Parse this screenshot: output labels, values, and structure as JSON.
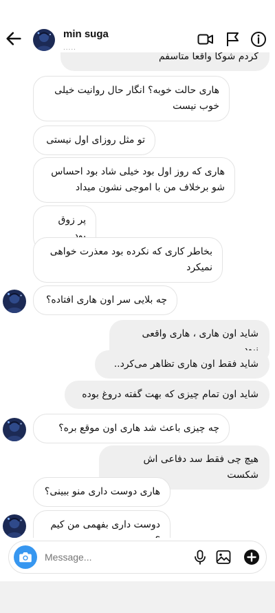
{
  "header": {
    "name": "min suga",
    "status": "....."
  },
  "icons": {
    "back": "arrow-left-icon",
    "video": "video-call-icon",
    "flag": "flag-icon",
    "info": "info-icon",
    "camera": "camera-icon",
    "mic": "microphone-icon",
    "gallery": "gallery-icon",
    "plus": "plus-icon"
  },
  "colors": {
    "accent": "#3797f0",
    "outgoing_bubble": "#efefef",
    "incoming_border": "#e3e3e3"
  },
  "messages": [
    {
      "side": "out",
      "text": "کردم شوکا واقعا متاسفم"
    },
    {
      "side": "in",
      "text": "هاری حالت خوبه؟ انگار حال روانیت خیلی خوب نیست"
    },
    {
      "side": "in",
      "text": "تو مثل روزای اول نیستی"
    },
    {
      "side": "in",
      "text": "هاری که روز اول بود خیلی شاد بود احساس شو برخلاف من با اموجی نشون میداد"
    },
    {
      "side": "in",
      "text": "پر زوق بود"
    },
    {
      "side": "in",
      "text": "بخاطر کاری که نکرده بود معذرت خواهی نمیکرد"
    },
    {
      "side": "in",
      "text": "چه بلایی سر اون هاری افتاده؟"
    },
    {
      "side": "out",
      "text": "شاید اون هاری ، هاری واقعی نبود.."
    },
    {
      "side": "out",
      "text": "شاید فقط اون هاری تظاهر می‌کرد.."
    },
    {
      "side": "out",
      "text": "شاید اون تمام چیزی که بهت گفته دروغ بوده"
    },
    {
      "side": "in",
      "text": "چه چیزی باعث شد هاری اون موقع بره؟"
    },
    {
      "side": "out",
      "text": "هیچ چی فقط سد دفاعی اش شکست"
    },
    {
      "side": "in",
      "text": "هاری دوست داری منو ببینی؟"
    },
    {
      "side": "in",
      "text": "دوست داری بفهمی من کیم ؟"
    }
  ],
  "composer": {
    "placeholder": "Message..."
  }
}
